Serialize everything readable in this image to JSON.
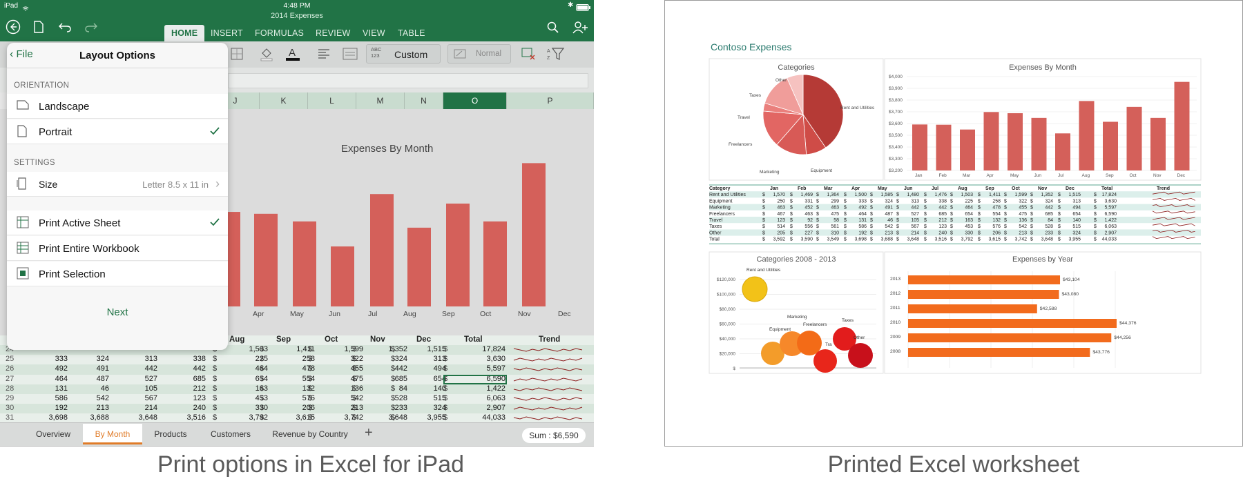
{
  "status": {
    "device": "iPad",
    "time": "4:48 PM",
    "doc_title": "2014 Expenses"
  },
  "ribbon": {
    "tabs": [
      "HOME",
      "INSERT",
      "FORMULAS",
      "REVIEW",
      "VIEW",
      "TABLE"
    ],
    "active": "HOME",
    "number_format": "Custom",
    "number_format_icon_text": "ABC\n123",
    "style": "Normal"
  },
  "panel": {
    "back_label": "File",
    "title": "Layout Options",
    "orientation_heading": "ORIENTATION",
    "landscape": "Landscape",
    "portrait": "Portrait",
    "settings_heading": "SETTINGS",
    "size_label": "Size",
    "size_value": "Letter 8.5 x 11 in",
    "print_active": "Print Active Sheet",
    "print_workbook": "Print Entire Workbook",
    "print_selection": "Print Selection",
    "next": "Next"
  },
  "grid": {
    "columns": [
      "J",
      "K",
      "L",
      "M",
      "N",
      "O",
      "P"
    ],
    "selected_column": "O",
    "chart_title": "Expenses By Month",
    "month_labels": [
      "Apr",
      "May",
      "Jun",
      "Jul",
      "Aug",
      "Sep",
      "Oct",
      "Nov",
      "Dec"
    ],
    "header": [
      "Aug",
      "Sep",
      "Oct",
      "Nov",
      "Dec",
      "Total",
      "Trend"
    ],
    "rows": [
      {
        "n": "24",
        "vals": [
          "1,503",
          "1,411",
          "1,599",
          "1,352",
          "1,515",
          "17,824"
        ]
      },
      {
        "n": "25",
        "vals": [
          "225",
          "258",
          "322",
          "324",
          "313",
          "3,630"
        ],
        "left": [
          "333",
          "324",
          "313",
          "338"
        ]
      },
      {
        "n": "26",
        "vals": [
          "464",
          "478",
          "455",
          "442",
          "494",
          "5,597"
        ],
        "left": [
          "492",
          "491",
          "442",
          "442"
        ]
      },
      {
        "n": "27",
        "vals": [
          "654",
          "554",
          "475",
          "685",
          "654",
          "6,590"
        ],
        "left": [
          "464",
          "487",
          "527",
          "685"
        ]
      },
      {
        "n": "28",
        "vals": [
          "163",
          "132",
          "136",
          "84",
          "140",
          "1,422"
        ],
        "left": [
          "131",
          "46",
          "105",
          "212"
        ]
      },
      {
        "n": "29",
        "vals": [
          "453",
          "576",
          "542",
          "528",
          "515",
          "6,063"
        ],
        "left": [
          "586",
          "542",
          "567",
          "123"
        ]
      },
      {
        "n": "30",
        "vals": [
          "330",
          "206",
          "213",
          "233",
          "324",
          "2,907"
        ],
        "left": [
          "192",
          "213",
          "214",
          "240"
        ]
      },
      {
        "n": "31",
        "vals": [
          "3,792",
          "3,615",
          "3,742",
          "3,648",
          "3,955",
          "44,033"
        ],
        "left": [
          "3,698",
          "3,688",
          "3,648",
          "3,516"
        ]
      }
    ],
    "sheets": [
      "Overview",
      "By Month",
      "Products",
      "Customers",
      "Revenue by Country"
    ],
    "active_sheet": "By Month",
    "sum_label": "Sum : $6,590"
  },
  "printed": {
    "title": "Contoso Expenses",
    "pie_title": "Categories",
    "pie_labels": [
      "Other",
      "Taxes",
      "Travel",
      "Freelancers",
      "Marketing",
      "Equipment",
      "Rent and Utilities"
    ],
    "bar_title": "Expenses By Month",
    "bar_yticks": [
      "$4,000",
      "$3,900",
      "$3,800",
      "$3,700",
      "$3,600",
      "$3,500",
      "$3,400",
      "$3,300",
      "$3,200"
    ],
    "months": [
      "Jan",
      "Feb",
      "Mar",
      "Apr",
      "May",
      "Jun",
      "Jul",
      "Aug",
      "Sep",
      "Oct",
      "Nov",
      "Dec"
    ],
    "table_header": [
      "Category",
      "Jan",
      "Feb",
      "Mar",
      "Apr",
      "May",
      "Jun",
      "Jul",
      "Aug",
      "Sep",
      "Oct",
      "Nov",
      "Dec",
      "Total",
      "Trend"
    ],
    "table_rows": [
      [
        "Rent and Utilities",
        "1,570",
        "1,469",
        "1,364",
        "1,500",
        "1,585",
        "1,480",
        "1,476",
        "1,503",
        "1,411",
        "1,599",
        "1,352",
        "1,515",
        "17,824"
      ],
      [
        "Equipment",
        "250",
        "331",
        "299",
        "333",
        "324",
        "313",
        "338",
        "225",
        "258",
        "322",
        "324",
        "313",
        "3,630"
      ],
      [
        "Marketing",
        "463",
        "452",
        "463",
        "492",
        "491",
        "442",
        "442",
        "464",
        "478",
        "455",
        "442",
        "494",
        "5,597"
      ],
      [
        "Freelancers",
        "467",
        "463",
        "475",
        "464",
        "487",
        "527",
        "685",
        "654",
        "554",
        "475",
        "685",
        "654",
        "6,590"
      ],
      [
        "Travel",
        "123",
        "92",
        "58",
        "131",
        "46",
        "105",
        "212",
        "163",
        "132",
        "136",
        "84",
        "140",
        "1,422"
      ],
      [
        "Taxes",
        "514",
        "556",
        "561",
        "586",
        "542",
        "567",
        "123",
        "453",
        "576",
        "542",
        "528",
        "515",
        "6,063"
      ],
      [
        "Other",
        "205",
        "227",
        "310",
        "192",
        "213",
        "214",
        "240",
        "330",
        "206",
        "213",
        "233",
        "324",
        "2,907"
      ],
      [
        "Total",
        "3,592",
        "3,590",
        "3,549",
        "3,698",
        "3,688",
        "3,648",
        "3,516",
        "3,792",
        "3,615",
        "3,742",
        "3,648",
        "3,955",
        "44,033"
      ]
    ],
    "bubble_title": "Categories 2008 - 2013",
    "bubble_yticks": [
      "$120,000",
      "$100,000",
      "$80,000",
      "$60,000",
      "$40,000",
      "$20,000",
      "$"
    ],
    "bubble_labels": [
      "Rent and Utilities",
      "Marketing",
      "Equipment",
      "Freelancers",
      "Taxes",
      "Other",
      "Tra"
    ],
    "year_title": "Expenses by Year",
    "years": [
      {
        "year": "2013",
        "value": "$43,104"
      },
      {
        "year": "2012",
        "value": "$43,080"
      },
      {
        "year": "2011",
        "value": "$42,588"
      },
      {
        "year": "2010",
        "value": "$44,376"
      },
      {
        "year": "2009",
        "value": "$44,256"
      },
      {
        "year": "2008",
        "value": "$43,776"
      }
    ]
  },
  "captions": {
    "left": "Print options in Excel for iPad",
    "right": "Printed Excel worksheet"
  },
  "chart_data": [
    {
      "type": "bar",
      "title": "Expenses By Month",
      "categories": [
        "Jan",
        "Feb",
        "Mar",
        "Apr",
        "May",
        "Jun",
        "Jul",
        "Aug",
        "Sep",
        "Oct",
        "Nov",
        "Dec"
      ],
      "values": [
        3592,
        3590,
        3549,
        3698,
        3688,
        3648,
        3516,
        3792,
        3615,
        3742,
        3648,
        3955
      ],
      "ylim": [
        3200,
        4000
      ]
    },
    {
      "type": "pie",
      "title": "Categories",
      "categories": [
        "Rent and Utilities",
        "Equipment",
        "Marketing",
        "Freelancers",
        "Travel",
        "Taxes",
        "Other"
      ],
      "values": [
        17824,
        3630,
        5597,
        6590,
        1422,
        6063,
        2907
      ]
    },
    {
      "type": "bar",
      "title": "Expenses by Year",
      "categories": [
        "2013",
        "2012",
        "2011",
        "2010",
        "2009",
        "2008"
      ],
      "values": [
        43104,
        43080,
        42588,
        44376,
        44256,
        43776
      ]
    }
  ],
  "colors": {
    "excel_green": "#217346",
    "bar_red": "#d4605a",
    "orange": "#f26b1d"
  }
}
